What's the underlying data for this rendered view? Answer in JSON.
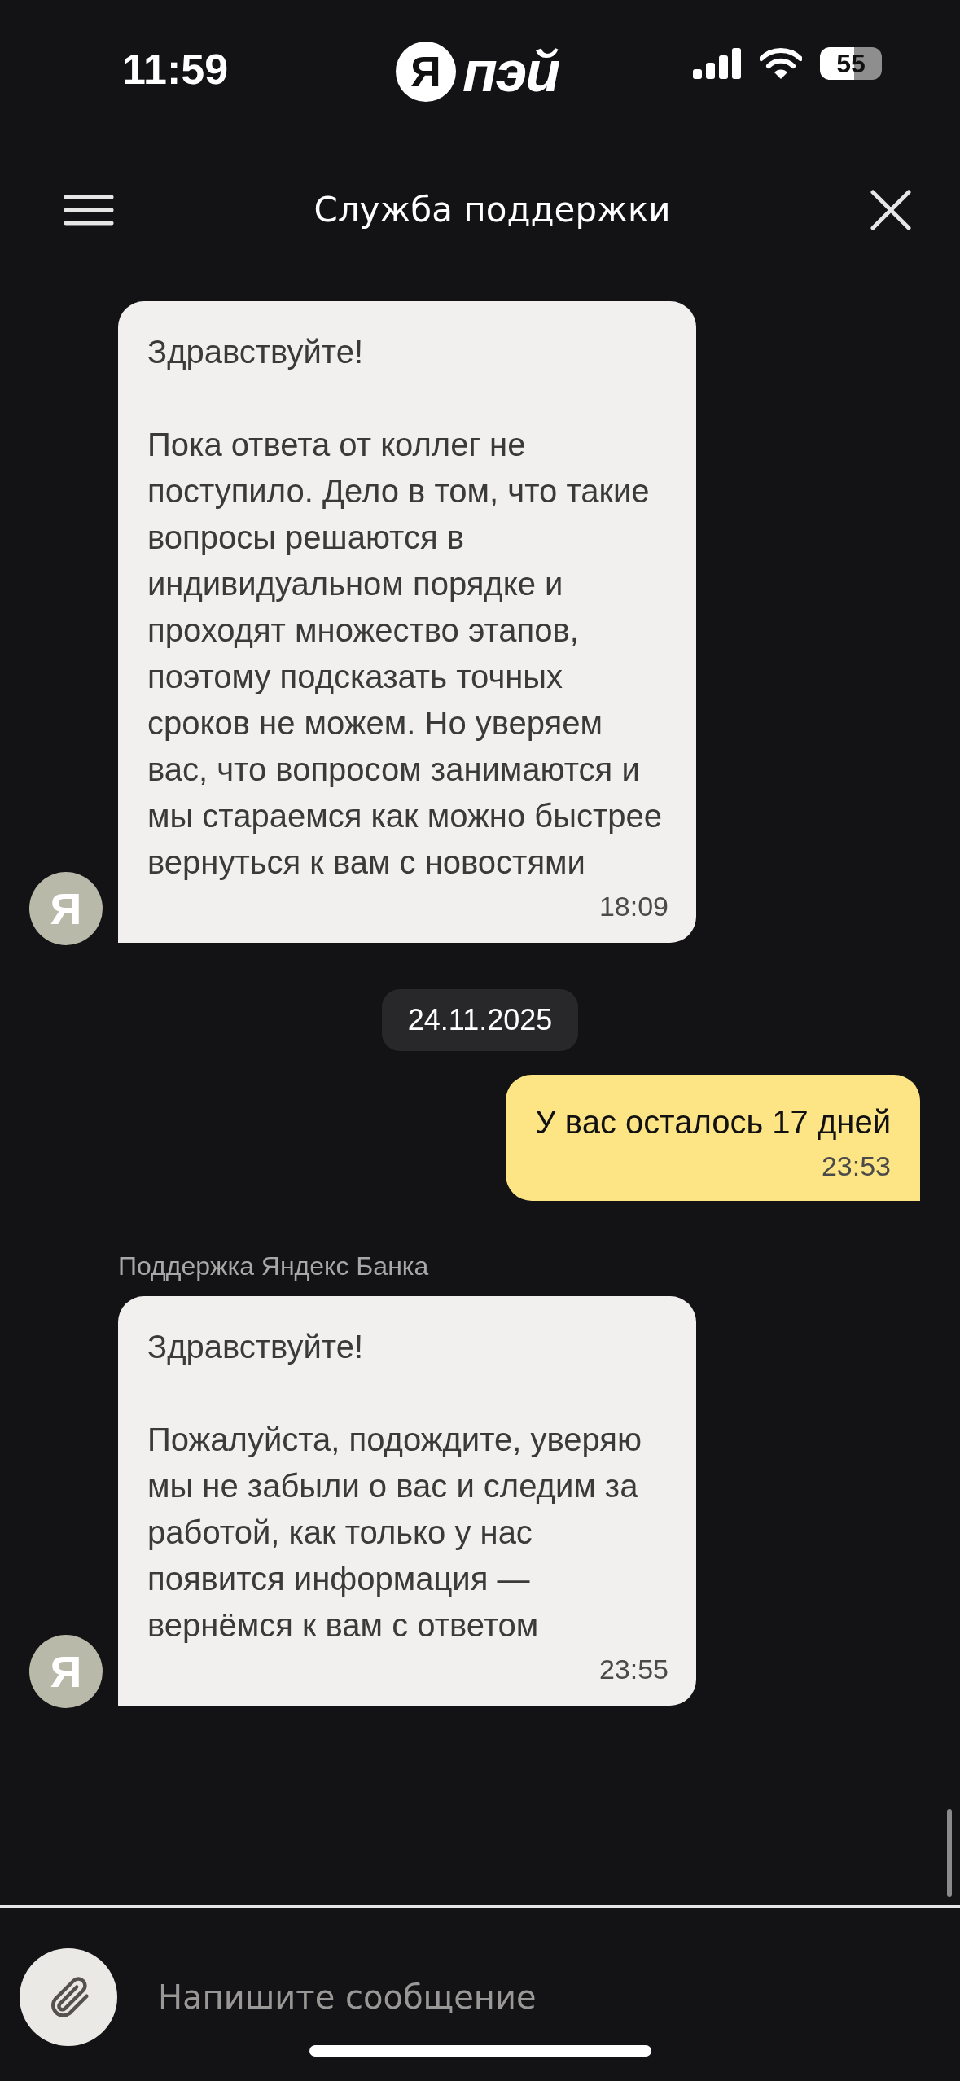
{
  "status_bar": {
    "time": "11:59",
    "battery": "55"
  },
  "logo": {
    "mark": "Я",
    "word": "пэй"
  },
  "header": {
    "title": "Служба поддержки"
  },
  "messages": [
    {
      "kind": "incoming",
      "avatar": "Я",
      "greeting": "Здравствуйте!",
      "body": "Пока ответа от коллег не поступило. Дело в том, что такие вопросы решаются в индивидуальном порядке и проходят множество этапов, поэтому подсказать точных сроков не можем. Но уверяем вас, что вопросом занимаются и мы стараемся как можно быстрее вернуться к вам с новостями",
      "time": "18:09"
    },
    {
      "kind": "date",
      "text": "24.11.2025"
    },
    {
      "kind": "outgoing",
      "body": "У вас осталось 17 дней",
      "time": "23:53"
    },
    {
      "kind": "incoming",
      "sender": "Поддержка Яндекс Банка",
      "avatar": "Я",
      "greeting": "Здравствуйте!",
      "body": "Пожалуйста, подождите, уверяю мы не забыли о вас и следим за работой, как только у нас появится информация — вернёмся к вам с ответом",
      "time": "23:55"
    }
  ],
  "composer": {
    "placeholder": "Напишите сообщение"
  }
}
